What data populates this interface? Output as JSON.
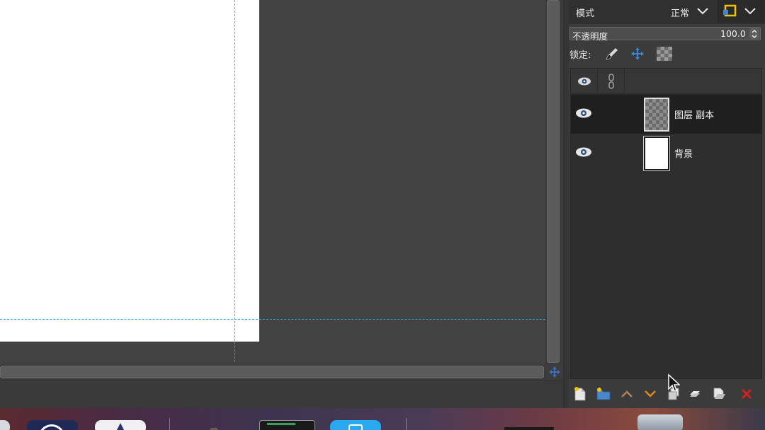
{
  "layers_panel": {
    "mode_label": "模式",
    "mode_value": "正常",
    "opacity_label": "不透明度",
    "opacity_value": "100.0",
    "lock_label": "锁定:",
    "layers": [
      {
        "name": "图层 副本",
        "selected": true,
        "thumbnail": "transparent-checker",
        "visible": true
      },
      {
        "name": "背景",
        "selected": false,
        "thumbnail": "white",
        "visible": true
      }
    ],
    "toolbar_icons": [
      "new-layer-icon",
      "new-layer-group-icon",
      "raise-layer-icon",
      "lower-layer-icon",
      "duplicate-layer-icon",
      "anchor-layer-icon",
      "merge-layer-icon",
      "delete-layer-icon"
    ]
  },
  "colors": {
    "guide": "#2aa6d8",
    "accent_yellow": "#f2c200",
    "raise_arrow": "#b0805a",
    "lower_arrow": "#e08a1e",
    "delete_red": "#d02020",
    "move_blue": "#3a86d8"
  }
}
